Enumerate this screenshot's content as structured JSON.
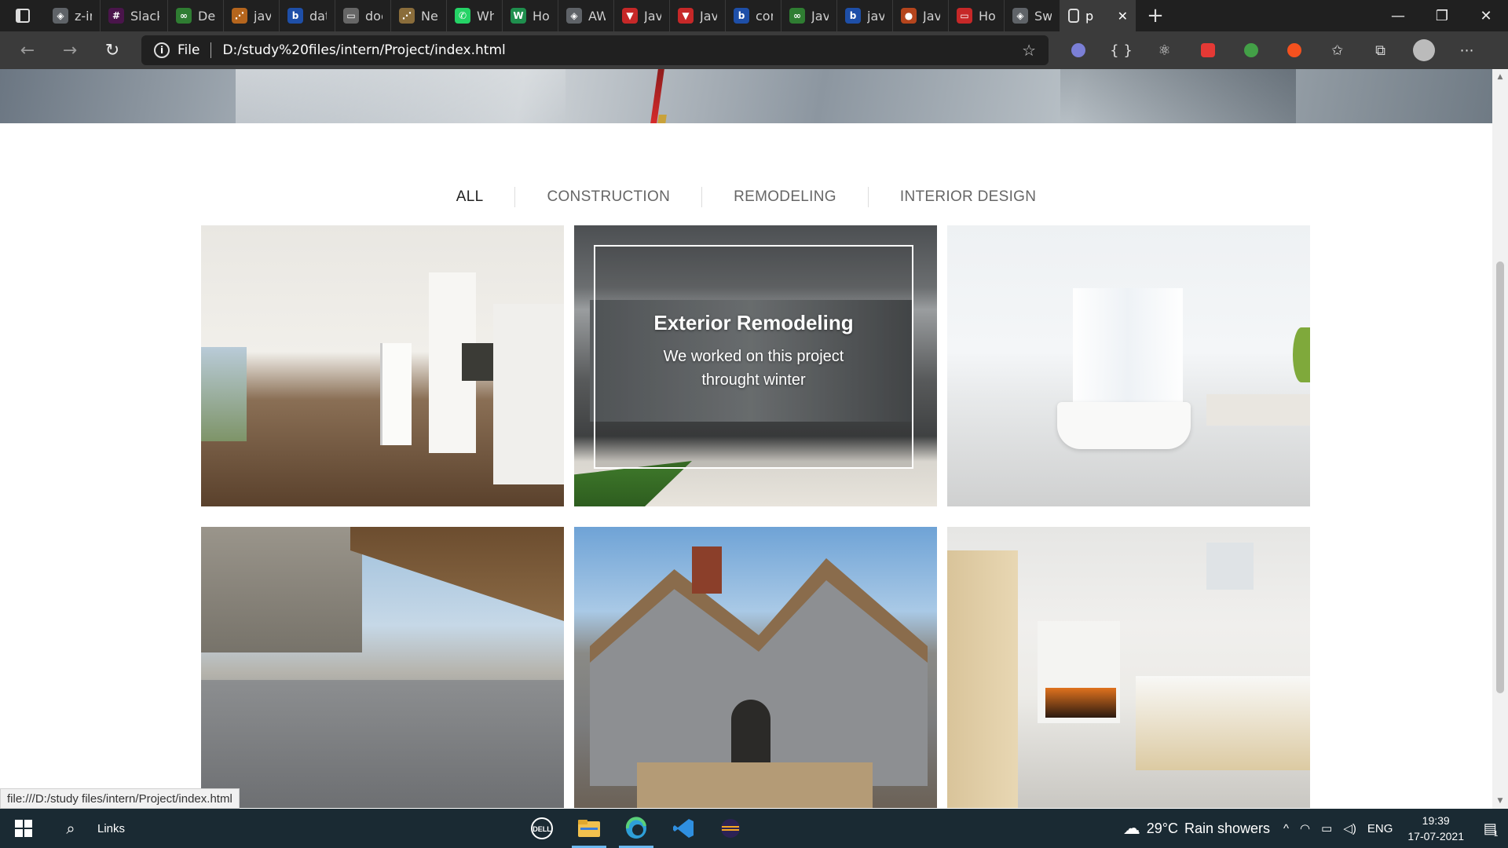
{
  "browser": {
    "tabs": [
      {
        "label": "z-ind",
        "color": "#5f6368",
        "glyph": "◈"
      },
      {
        "label": "Slack",
        "color": "#4a154b",
        "glyph": "#"
      },
      {
        "label": "Desig",
        "color": "#2f7d32",
        "glyph": "∞"
      },
      {
        "label": "javas",
        "color": "#b5651d",
        "glyph": "⋰"
      },
      {
        "label": "data-",
        "color": "#1e4fa8",
        "glyph": "b"
      },
      {
        "label": "docu",
        "color": "#666666",
        "glyph": "▭"
      },
      {
        "label": "Next",
        "color": "#8a6d3b",
        "glyph": "⋰"
      },
      {
        "label": "What",
        "color": "#25d366",
        "glyph": "✆"
      },
      {
        "label": "How",
        "color": "#1f8f4e",
        "glyph": "W"
      },
      {
        "label": "AWT",
        "color": "#5f6368",
        "glyph": "◈"
      },
      {
        "label": "Java",
        "color": "#c62828",
        "glyph": "▼"
      },
      {
        "label": "Java",
        "color": "#c62828",
        "glyph": "▼"
      },
      {
        "label": "conta",
        "color": "#1e4fa8",
        "glyph": "b"
      },
      {
        "label": "Java",
        "color": "#2f7d32",
        "glyph": "∞"
      },
      {
        "label": "java",
        "color": "#1e4fa8",
        "glyph": "b"
      },
      {
        "label": "Java",
        "color": "#b5451d",
        "glyph": "●"
      },
      {
        "label": "How",
        "color": "#c62828",
        "glyph": "▭"
      },
      {
        "label": "Swing",
        "color": "#5f6368",
        "glyph": "◈"
      }
    ],
    "active_tab": {
      "label": "p",
      "close": "✕"
    },
    "new_tab": "+",
    "window_controls": {
      "minimize": "—",
      "restore": "❐",
      "close": "✕"
    },
    "nav": {
      "back": "←",
      "forward": "→",
      "reload": "↻"
    },
    "address": {
      "protocol": "File",
      "url": "D:/study%20files/intern/Project/index.html",
      "info": "i",
      "favorite": "☆"
    },
    "extensions": [
      "☺",
      "{ }",
      "⚛",
      "▤",
      "✿",
      "◉",
      "✩",
      "⧉",
      "",
      "⋯"
    ],
    "status_url": "file:///D:/study files/intern/Project/index.html"
  },
  "page": {
    "filters": [
      {
        "label": "ALL",
        "active": true
      },
      {
        "label": "CONSTRUCTION",
        "active": false
      },
      {
        "label": "REMODELING",
        "active": false
      },
      {
        "label": "INTERIOR DESIGN",
        "active": false
      }
    ],
    "hover_card": {
      "title": "Exterior Remodeling",
      "description": "We worked on this project throught winter"
    }
  },
  "taskbar": {
    "search_icon": "⌕",
    "links_label": "Links",
    "apps": [
      "dell-icon",
      "file-explorer-icon",
      "edge-icon",
      "vscode-icon",
      "eclipse-icon"
    ],
    "weather": {
      "temp": "29°C",
      "condition": "Rain showers"
    },
    "tray": {
      "chevron": "^",
      "language": "ENG"
    },
    "clock": {
      "time": "19:39",
      "date": "17-07-2021"
    },
    "notification_count": "1"
  }
}
